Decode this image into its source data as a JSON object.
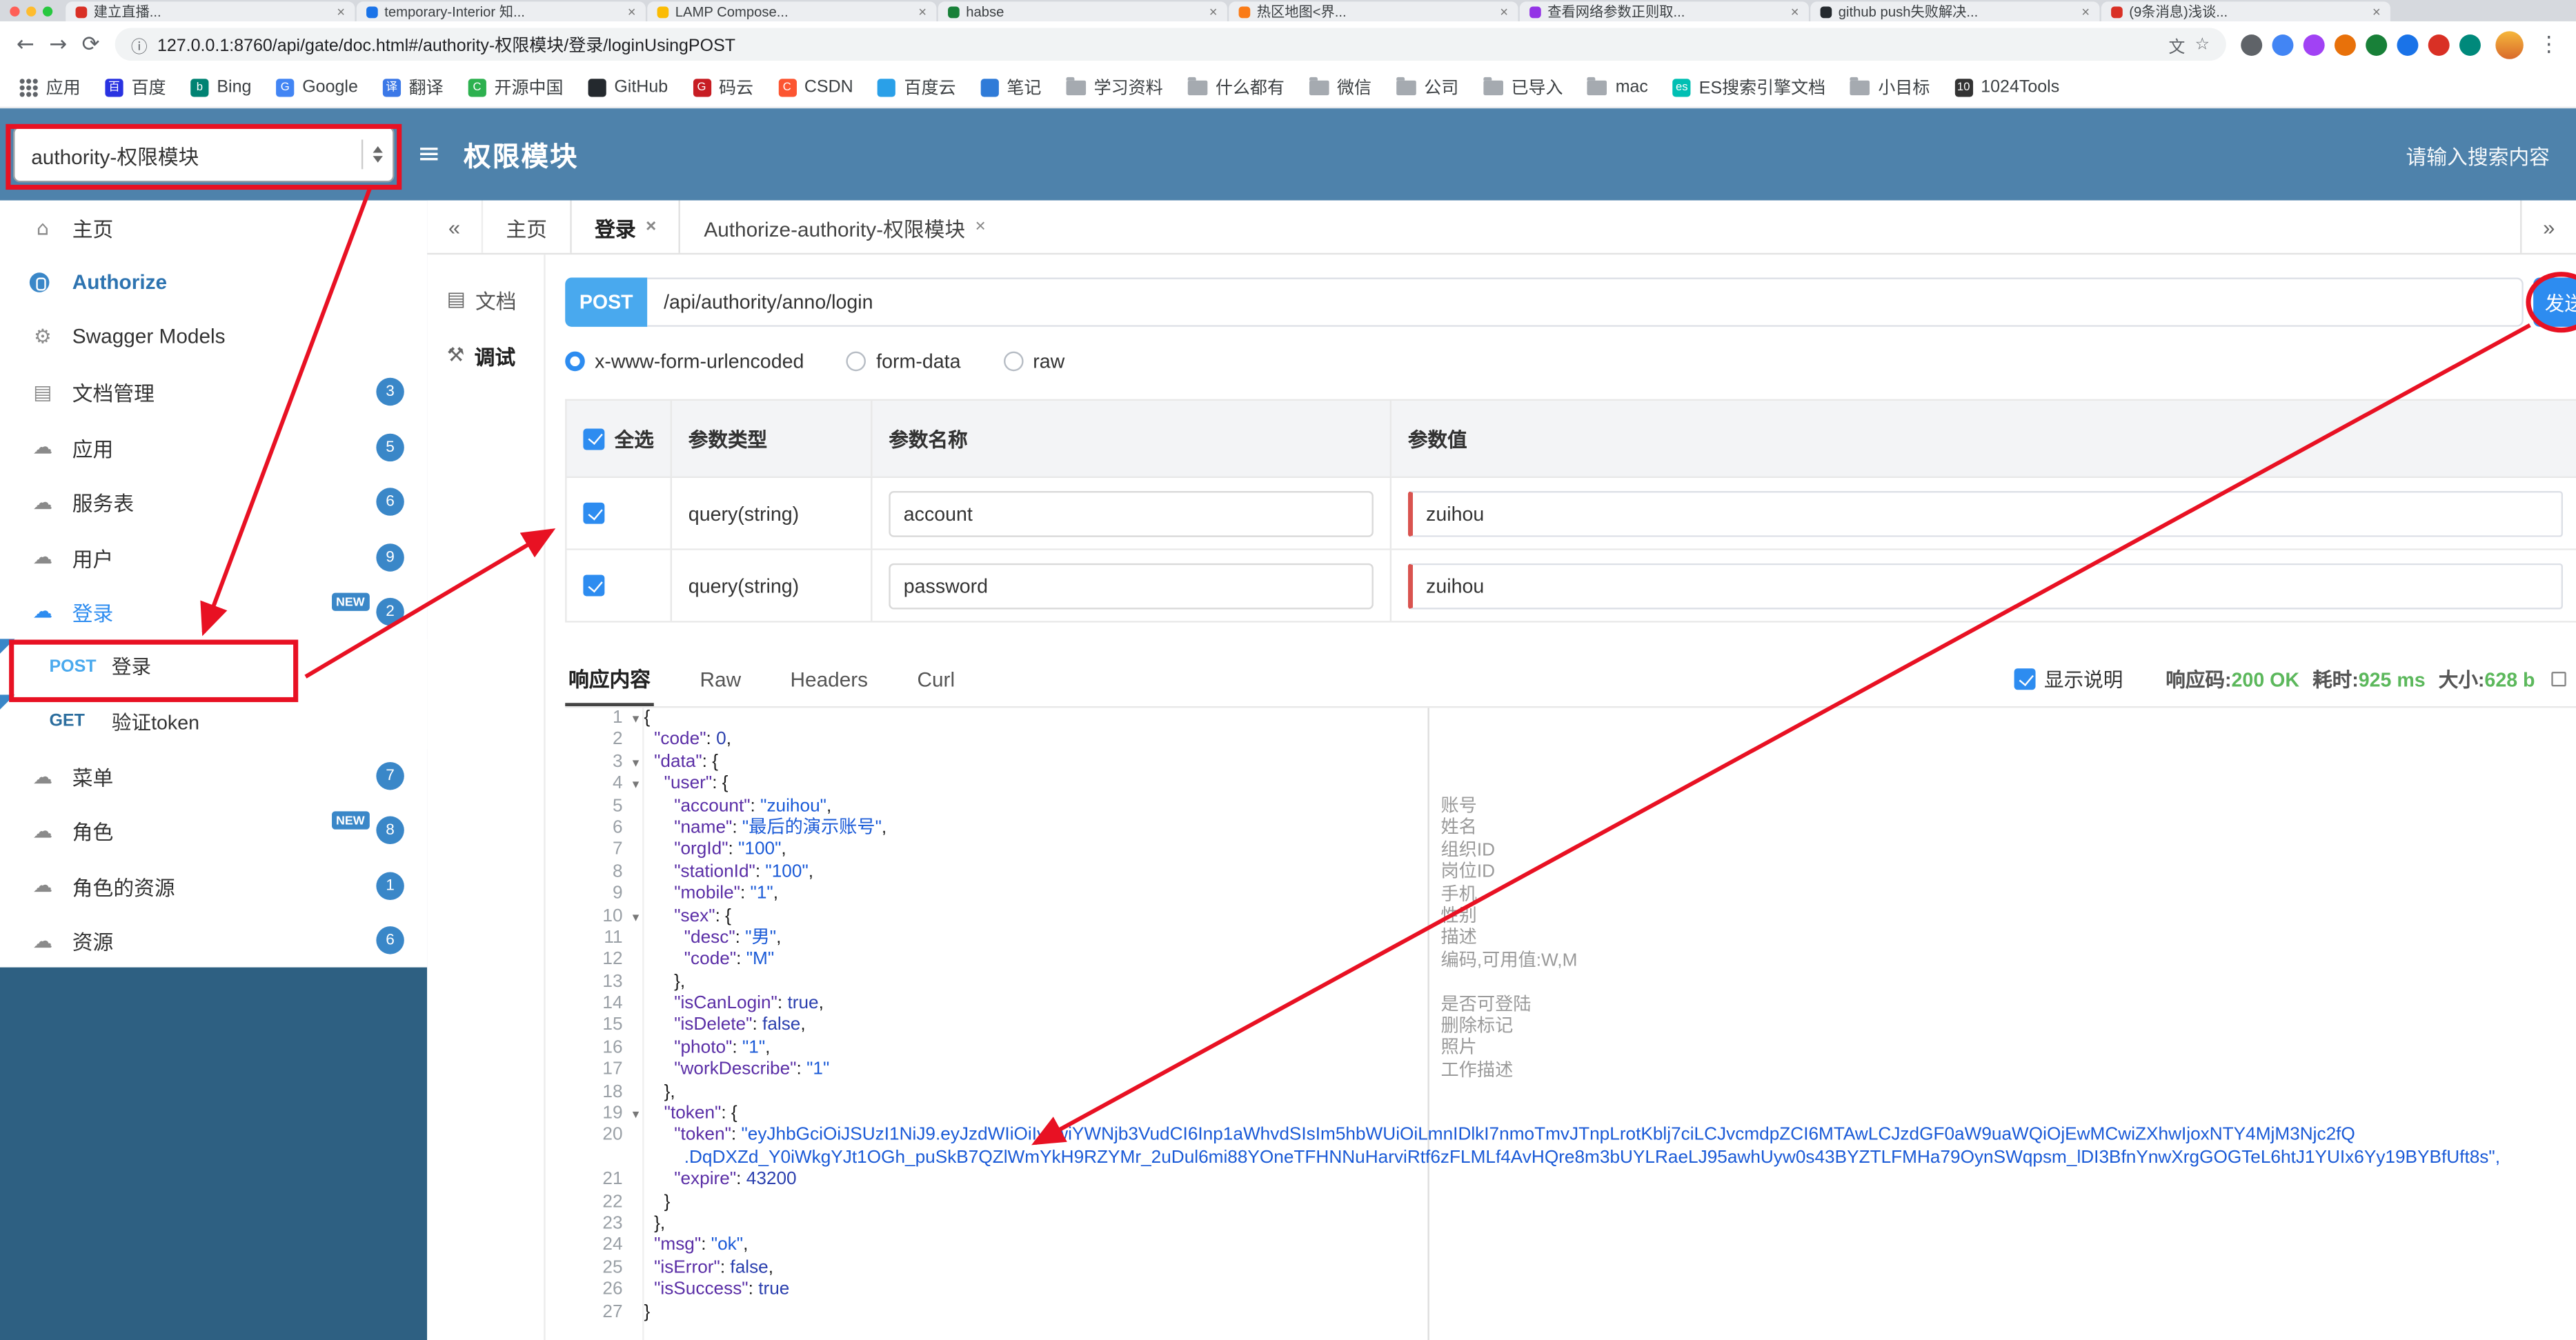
{
  "browser": {
    "tabs": [
      {
        "title": "建立直播...",
        "color": "#d93025"
      },
      {
        "title": "temporary-Interior 知...",
        "color": "#1a73e8"
      },
      {
        "title": "LAMP Compose...",
        "color": "#fbbc04"
      },
      {
        "title": "habse",
        "color": "#188038"
      },
      {
        "title": "热区地图<界...",
        "color": "#fa7b17"
      },
      {
        "title": "查看网络参数正则取...",
        "color": "#9334e6"
      },
      {
        "title": "github push失败解决...",
        "color": "#24292e"
      },
      {
        "title": "(9条消息)浅谈...",
        "color": "#d93025"
      }
    ],
    "url": "127.0.0.1:8760/api/gate/doc.html#/authority-权限模块/登录/loginUsingPOST",
    "extension_colors": [
      "#5f6368",
      "#4285f4",
      "#a142f4",
      "#e8710a",
      "#188038",
      "#1a73e8",
      "#d93025",
      "#00897b"
    ],
    "bookmarks": [
      {
        "label": "应用",
        "type": "apps"
      },
      {
        "label": "百度",
        "type": "site",
        "color": "#2932e1",
        "letter": "百"
      },
      {
        "label": "Bing",
        "type": "site",
        "color": "#008373",
        "letter": "b"
      },
      {
        "label": "Google",
        "type": "site",
        "color": "#4285f4",
        "letter": "G"
      },
      {
        "label": "翻译",
        "type": "site",
        "color": "#3b78e7",
        "letter": "译"
      },
      {
        "label": "开源中国",
        "type": "site",
        "color": "#2db14f",
        "letter": "C"
      },
      {
        "label": "GitHub",
        "type": "site",
        "color": "#24292e",
        "letter": ""
      },
      {
        "label": "码云",
        "type": "site",
        "color": "#c71d23",
        "letter": "G"
      },
      {
        "label": "CSDN",
        "type": "site",
        "color": "#fc5531",
        "letter": "C"
      },
      {
        "label": "百度云",
        "type": "site",
        "color": "#2aa0e8",
        "letter": ""
      },
      {
        "label": "笔记",
        "type": "site",
        "color": "#2f7bd8",
        "letter": ""
      },
      {
        "label": "学习资料",
        "type": "folder"
      },
      {
        "label": "什么都有",
        "type": "folder"
      },
      {
        "label": "微信",
        "type": "folder"
      },
      {
        "label": "公司",
        "type": "folder"
      },
      {
        "label": "已导入",
        "type": "folder"
      },
      {
        "label": "mac",
        "type": "folder"
      },
      {
        "label": "ES搜索引擎文档",
        "type": "site",
        "color": "#00bfb3",
        "letter": "es"
      },
      {
        "label": "小目标",
        "type": "folder"
      },
      {
        "label": "1024Tools",
        "type": "site",
        "color": "#333333",
        "letter": "10"
      }
    ]
  },
  "header": {
    "project_select": "authority-权限模块",
    "title": "权限模块",
    "search_placeholder": "请输入搜索内容"
  },
  "sidebar": {
    "items": [
      {
        "icon": "home",
        "label": "主页"
      },
      {
        "icon": "authorize",
        "label": "Authorize",
        "accent": true
      },
      {
        "icon": "models",
        "label": "Swagger Models"
      },
      {
        "icon": "doc",
        "label": "文档管理",
        "badge": "3"
      },
      {
        "icon": "cloud",
        "label": "应用",
        "badge": "5"
      },
      {
        "icon": "cloud",
        "label": "服务表",
        "badge": "6"
      },
      {
        "icon": "cloud",
        "label": "用户",
        "badge": "9"
      },
      {
        "icon": "cloud",
        "label": "登录",
        "badge": "2",
        "isNew": true,
        "active": true
      },
      {
        "type": "child",
        "method": "POST",
        "label": "登录",
        "flag": true
      },
      {
        "type": "child",
        "method": "GET",
        "label": "验证token",
        "flag": true
      },
      {
        "icon": "cloud",
        "label": "菜单",
        "badge": "7"
      },
      {
        "icon": "cloud",
        "label": "角色",
        "badge": "8",
        "isNew": true
      },
      {
        "icon": "cloud",
        "label": "角色的资源",
        "badge": "1"
      },
      {
        "icon": "cloud",
        "label": "资源",
        "badge": "6"
      }
    ]
  },
  "doc_tabs": {
    "left_chevron": "«",
    "right_chevron": "»",
    "tabs": [
      {
        "label": "主页",
        "closable": false
      },
      {
        "label": "登录",
        "closable": true,
        "active": true
      },
      {
        "label": "Authorize-authority-权限模块",
        "closable": true
      }
    ]
  },
  "subnav": {
    "items": [
      {
        "label": "文档",
        "icon": "doc-icon"
      },
      {
        "label": "调试",
        "icon": "debug-icon",
        "active": true
      }
    ]
  },
  "request": {
    "method": "POST",
    "url": "/api/authority/anno/login",
    "send_label": "发送",
    "content_types": [
      {
        "label": "x-www-form-urlencoded",
        "checked": true
      },
      {
        "label": "form-data",
        "checked": false
      },
      {
        "label": "raw",
        "checked": false
      }
    ]
  },
  "params_table": {
    "headers": {
      "select": "全选",
      "type": "参数类型",
      "name": "参数名称",
      "value": "参数值"
    },
    "rows": [
      {
        "checked": true,
        "type": "query(string)",
        "name": "account",
        "value": "zuihou"
      },
      {
        "checked": true,
        "type": "query(string)",
        "name": "password",
        "value": "zuihou"
      }
    ]
  },
  "response": {
    "tabs": [
      {
        "label": "响应内容",
        "active": true
      },
      {
        "label": "Raw",
        "active": false
      },
      {
        "label": "Headers",
        "active": false
      },
      {
        "label": "Curl",
        "active": false
      }
    ],
    "show_desc_label": "显示说明",
    "show_desc_checked": true,
    "meta": {
      "code_label": "响应码:",
      "code": "200 OK",
      "time_label": "耗时:",
      "time": "925 ms",
      "size_label": "大小:",
      "size": "628 b"
    }
  },
  "code": {
    "lines": [
      {
        "n": "1",
        "fold": true,
        "t": "{"
      },
      {
        "n": "2",
        "t": "  \"code\": 0,"
      },
      {
        "n": "3",
        "fold": true,
        "t": "  \"data\": {"
      },
      {
        "n": "4",
        "fold": true,
        "t": "    \"user\": {"
      },
      {
        "n": "5",
        "t": "      \"account\": \"zuihou\",",
        "anno": "账号"
      },
      {
        "n": "6",
        "t": "      \"name\": \"最后的演示账号\",",
        "anno": "姓名"
      },
      {
        "n": "7",
        "t": "      \"orgId\": \"100\",",
        "anno": "组织ID"
      },
      {
        "n": "8",
        "t": "      \"stationId\": \"100\",",
        "anno": "岗位ID"
      },
      {
        "n": "9",
        "t": "      \"mobile\": \"1\",",
        "anno": "手机"
      },
      {
        "n": "10",
        "fold": true,
        "t": "      \"sex\": {",
        "anno": "性别"
      },
      {
        "n": "11",
        "t": "        \"desc\": \"男\",",
        "anno": "描述"
      },
      {
        "n": "12",
        "t": "        \"code\": \"M\"",
        "anno": "编码,可用值:W,M"
      },
      {
        "n": "13",
        "t": "      },"
      },
      {
        "n": "14",
        "t": "      \"isCanLogin\": true,",
        "anno": "是否可登陆"
      },
      {
        "n": "15",
        "t": "      \"isDelete\": false,",
        "anno": "删除标记"
      },
      {
        "n": "16",
        "t": "      \"photo\": \"1\",",
        "anno": "照片"
      },
      {
        "n": "17",
        "t": "      \"workDescribe\": \"1\"",
        "anno": "工作描述"
      },
      {
        "n": "18",
        "t": "    },"
      },
      {
        "n": "19",
        "fold": true,
        "t": "    \"token\": {"
      },
      {
        "n": "20",
        "t": "      \"token\": \"eyJhbGciOiJSUzI1NiJ9.eyJzdWIiOiIyIiwiYWNjb3VudCI6Inp1aWhvdSIsIm5hbWUiOiLmnIDlkI7nmoTmvJTnpLrotKblj7ciLCJvcmdpZCI6MTAwLCJzdGF0aW9uaWQiOjEwMCwiZXhwIjoxNTY4MjM3Njc2fQ"
      },
      {
        "n": "",
        "t": "        .DqDXZd_Y0iWkgYJt1OGh_puSkB7QZlWmYkH9RZYMr_2uDul6mi88YOneTFHNNuHarviRtf6zFLMLf4AvHQre8m3bUYLRaeLJ95awhUyw0s43BYZTLFMHa79OynSWqpsm_lDI3BfnYnwXrgGOGTeL6htJ1YUIx6Yy19BYBfUft8s\","
      },
      {
        "n": "21",
        "t": "      \"expire\": 43200"
      },
      {
        "n": "22",
        "t": "    }"
      },
      {
        "n": "23",
        "t": "  },"
      },
      {
        "n": "24",
        "t": "  \"msg\": \"ok\","
      },
      {
        "n": "25",
        "t": "  \"isError\": false,"
      },
      {
        "n": "26",
        "t": "  \"isSuccess\": true"
      },
      {
        "n": "27",
        "t": "}"
      }
    ]
  }
}
